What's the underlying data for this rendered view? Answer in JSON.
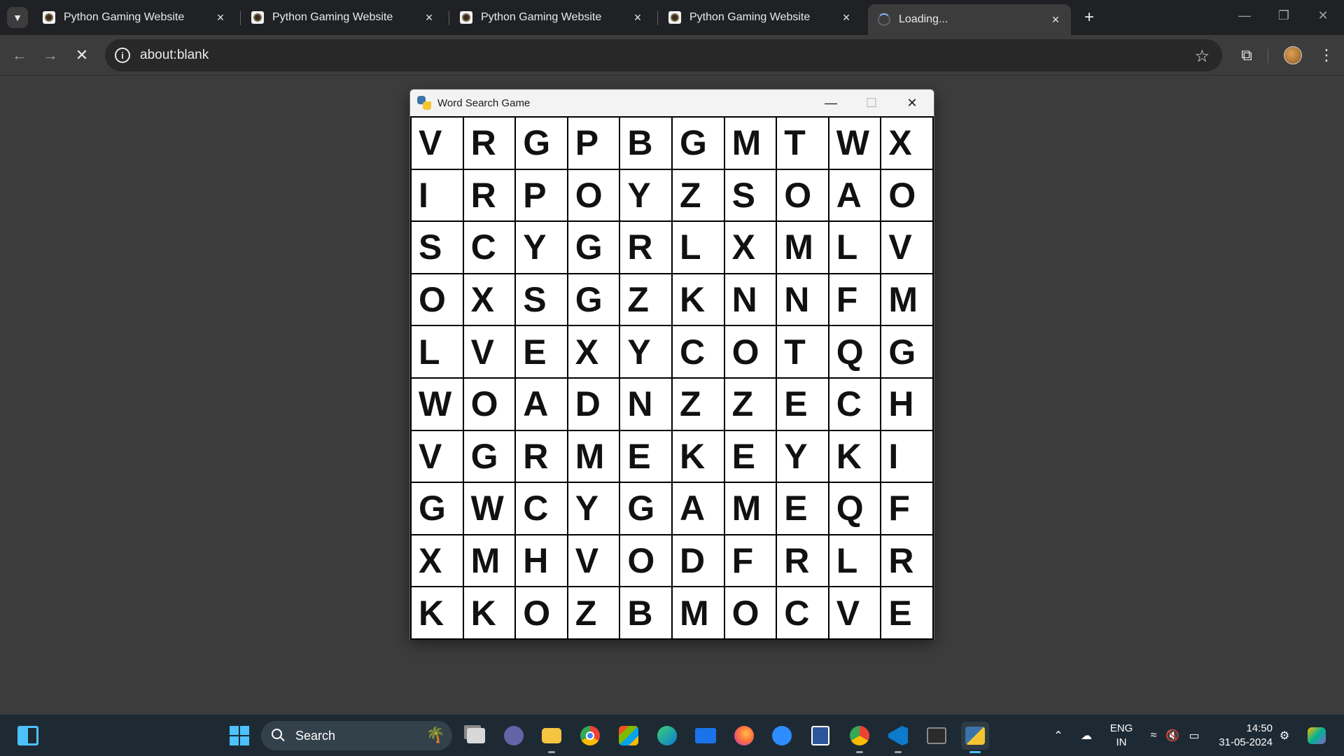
{
  "browser": {
    "tabs": [
      {
        "title": "Python Gaming Website",
        "close": "×"
      },
      {
        "title": "Python Gaming Website",
        "close": "×"
      },
      {
        "title": "Python Gaming Website",
        "close": "×"
      },
      {
        "title": "Python Gaming Website",
        "close": "×"
      },
      {
        "title": "Loading...",
        "close": "×"
      }
    ],
    "new_tab": "+",
    "window_controls": {
      "minimize": "—",
      "restore": "❐",
      "close": "✕"
    },
    "nav": {
      "back": "←",
      "forward": "→",
      "stop": "✕"
    },
    "omnibox": {
      "info": "i",
      "url": "about:blank",
      "bookmark": "☆"
    },
    "toolbar_right": {
      "extensions": "⧉",
      "menu": "⋮"
    }
  },
  "game_window": {
    "title": "Word Search Game",
    "controls": {
      "minimize": "—",
      "maximize": "☐",
      "close": "✕"
    },
    "grid": [
      [
        "V",
        "R",
        "G",
        "P",
        "B",
        "G",
        "M",
        "T",
        "W",
        "X"
      ],
      [
        "I",
        "R",
        "P",
        "O",
        "Y",
        "Z",
        "S",
        "O",
        "A",
        "O"
      ],
      [
        "S",
        "C",
        "Y",
        "G",
        "R",
        "L",
        "X",
        "M",
        "L",
        "V"
      ],
      [
        "O",
        "X",
        "S",
        "G",
        "Z",
        "K",
        "N",
        "N",
        "F",
        "M"
      ],
      [
        "L",
        "V",
        "E",
        "X",
        "Y",
        "C",
        "O",
        "T",
        "Q",
        "G"
      ],
      [
        "W",
        "O",
        "A",
        "D",
        "N",
        "Z",
        "Z",
        "E",
        "C",
        "H"
      ],
      [
        "V",
        "G",
        "R",
        "M",
        "E",
        "K",
        "E",
        "Y",
        "K",
        "I"
      ],
      [
        "G",
        "W",
        "C",
        "Y",
        "G",
        "A",
        "M",
        "E",
        "Q",
        "F"
      ],
      [
        "X",
        "M",
        "H",
        "V",
        "O",
        "D",
        "F",
        "R",
        "L",
        "R"
      ],
      [
        "K",
        "K",
        "O",
        "Z",
        "B",
        "M",
        "O",
        "C",
        "V",
        "E"
      ]
    ]
  },
  "taskbar": {
    "search_label": "Search",
    "tray": {
      "lang_top": "ENG",
      "lang_bottom": "IN",
      "time": "14:50",
      "date": "31-05-2024"
    }
  },
  "colors": {
    "accent": "#4cc2ff",
    "browser_bg": "#3c3c3c",
    "tabstrip": "#202124",
    "taskbar": "#1e2a33"
  }
}
